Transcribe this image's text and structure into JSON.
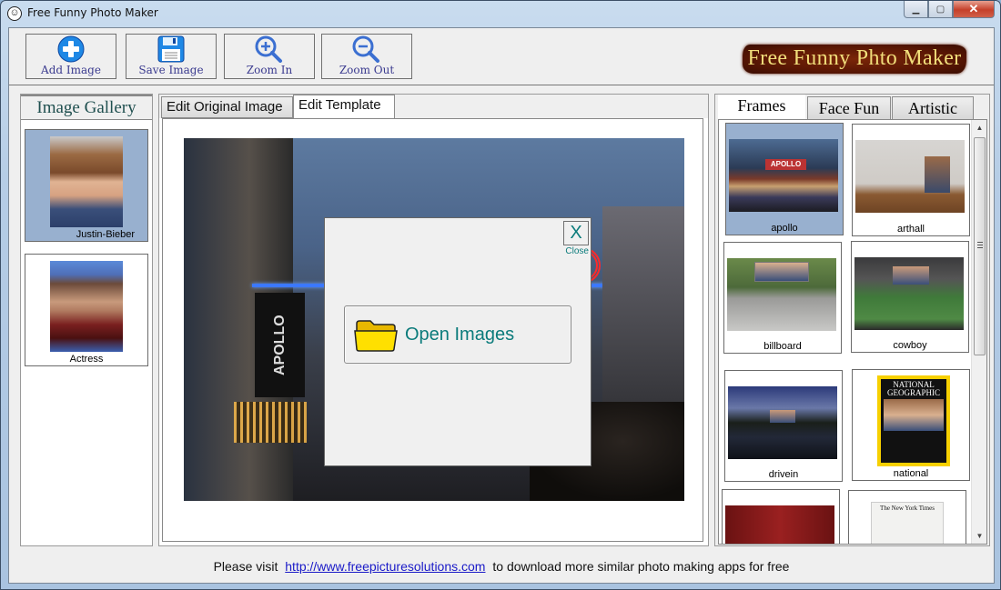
{
  "window": {
    "title": "Free Funny Photo Maker",
    "controls": {
      "minimize": "▁",
      "maximize": "▢",
      "close": "✕"
    }
  },
  "toolbar": {
    "buttons": [
      {
        "label": "Add Image",
        "icon": "add-circle-icon"
      },
      {
        "label": "Save Image",
        "icon": "floppy-disk-icon"
      },
      {
        "label": "Zoom In",
        "icon": "zoom-in-icon"
      },
      {
        "label": "Zoom Out",
        "icon": "zoom-out-icon"
      }
    ],
    "logo_text": "Free Funny Phto Maker"
  },
  "gallery": {
    "title": "Image Gallery",
    "items": [
      {
        "caption": "Justin-Bieber",
        "selected": true
      },
      {
        "caption": "Actress",
        "selected": false
      }
    ]
  },
  "center": {
    "tabs": [
      {
        "label": "Edit Original Image",
        "active": false
      },
      {
        "label": "Edit Template",
        "active": true
      }
    ],
    "dialog": {
      "close_glyph": "X",
      "close_label": "Close",
      "open_button_label": "Open Images"
    }
  },
  "frames_panel": {
    "tabs": [
      {
        "label": "Frames",
        "active": true
      },
      {
        "label": "Face Fun",
        "active": false
      },
      {
        "label": "Artistic",
        "active": false
      }
    ],
    "items": [
      {
        "caption": "apollo",
        "selected": true
      },
      {
        "caption": "arthall",
        "selected": false
      },
      {
        "caption": "billboard",
        "selected": false
      },
      {
        "caption": "cowboy",
        "selected": false
      },
      {
        "caption": "drivein",
        "selected": false
      },
      {
        "caption": "national",
        "selected": false
      },
      {
        "caption": "",
        "selected": false
      },
      {
        "caption": "",
        "selected": false
      }
    ],
    "national_cover_title": "NATIONAL GEOGRAPHIC",
    "newspaper_title": "The New York Times"
  },
  "footer": {
    "prefix": "Please visit",
    "link": "http://www.freepicturesolutions.com",
    "suffix": "to download more similar photo making apps for free"
  }
}
